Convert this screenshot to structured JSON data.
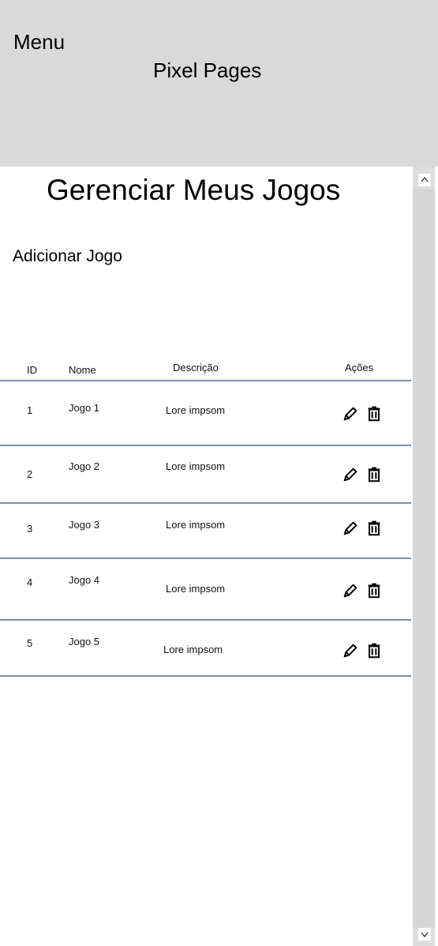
{
  "header": {
    "menu_label": "Menu",
    "site_title": "Pixel Pages"
  },
  "main": {
    "title": "Gerenciar Meus Jogos",
    "add_label": "Adicionar Jogo",
    "table": {
      "headers": {
        "id": "ID",
        "name": "Nome",
        "description": "Descrição",
        "actions": "Ações"
      },
      "rows": [
        {
          "id": "1",
          "name": "Jogo 1",
          "description": "Lore impsom"
        },
        {
          "id": "2",
          "name": "Jogo 2",
          "description": "Lore impsom"
        },
        {
          "id": "3",
          "name": "Jogo 3",
          "description": "Lore impsom"
        },
        {
          "id": "4",
          "name": "Jogo 4",
          "description": "Lore impsom"
        },
        {
          "id": "5",
          "name": "Jogo 5",
          "description": "Lore impsom"
        }
      ]
    }
  },
  "icons": {
    "edit": "pencil-icon",
    "delete": "trash-icon",
    "scroll_up": "chevron-up-icon",
    "scroll_down": "chevron-down-icon"
  },
  "colors": {
    "header_bg": "#d9d9d9",
    "row_divider": "#7b8fb1",
    "scrollbar": "#d6d6d6"
  }
}
